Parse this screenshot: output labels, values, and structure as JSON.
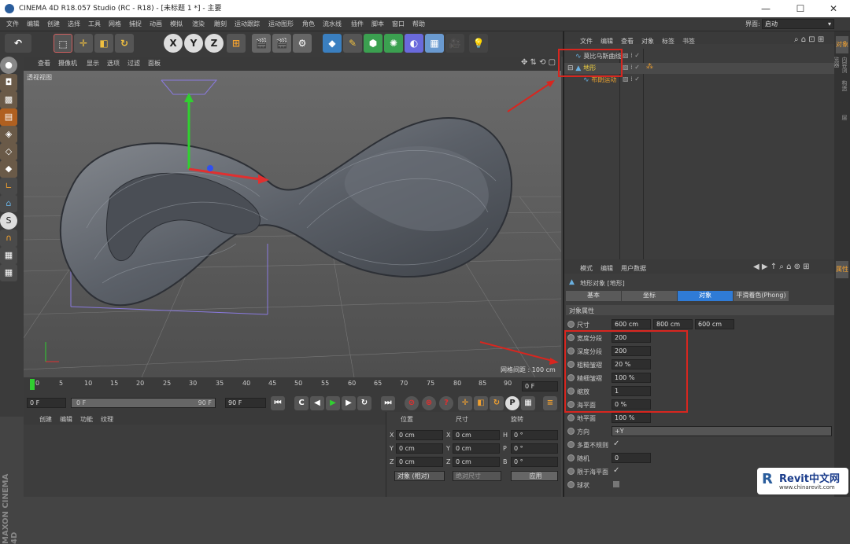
{
  "window": {
    "title": "CINEMA 4D R18.057 Studio (RC - R18) - [未标题 1 *] - 主要",
    "minimize": "—",
    "maximize": "☐",
    "close": "✕"
  },
  "menu": [
    "文件",
    "编辑",
    "创建",
    "选择",
    "工具",
    "网格",
    "捕捉",
    "动画",
    "模拟",
    "渲染",
    "雕刻",
    "运动跟踪",
    "运动图形",
    "角色",
    "流水线",
    "插件",
    "脚本",
    "窗口",
    "帮助"
  ],
  "layout": {
    "label": "界面:",
    "value": "启动"
  },
  "toolbar": {
    "x": "X",
    "y": "Y",
    "z": "Z"
  },
  "viewport": {
    "menu": [
      "查看",
      "摄像机",
      "显示",
      "选项",
      "过滤",
      "面板"
    ],
    "label": "透视视图",
    "grid": "网格间距 : 100 cm"
  },
  "timeline": {
    "ticks": [
      "0",
      "5",
      "10",
      "15",
      "20",
      "25",
      "30",
      "35",
      "40",
      "45",
      "50",
      "55",
      "60",
      "65",
      "70",
      "75",
      "80",
      "85",
      "90"
    ],
    "frame": "0 F"
  },
  "transport": {
    "start": "0 F",
    "slider_start": "0 F",
    "slider_end": "90 F",
    "end": "90 F"
  },
  "material": {
    "menu": [
      "创建",
      "编辑",
      "功能",
      "纹理"
    ]
  },
  "coords": {
    "headers": [
      "位置",
      "尺寸",
      "旋转"
    ],
    "rows": [
      {
        "a": "X",
        "v1": "0 cm",
        "b": "X",
        "v2": "0 cm",
        "c": "H",
        "v3": "0 °"
      },
      {
        "a": "Y",
        "v1": "0 cm",
        "b": "Y",
        "v2": "0 cm",
        "c": "P",
        "v3": "0 °"
      },
      {
        "a": "Z",
        "v1": "0 cm",
        "b": "Z",
        "v2": "0 cm",
        "c": "B",
        "v3": "0 °"
      }
    ],
    "mode": "对象 (相对)",
    "size": "绝对尺寸",
    "apply": "应用"
  },
  "objects": {
    "menu": [
      "文件",
      "编辑",
      "查看",
      "对象",
      "标签",
      "书签"
    ],
    "items": [
      {
        "name": "莫比乌斯曲线",
        "color": "#ccc"
      },
      {
        "name": "地形",
        "color": "#f0d040"
      },
      {
        "name": "布朗运动",
        "color": "#e8a030"
      }
    ]
  },
  "attributes": {
    "menu": [
      "模式",
      "编辑",
      "用户数据"
    ],
    "title": "地形对象 [地形]",
    "tabs": [
      "基本",
      "坐标",
      "对象",
      "平滑着色(Phong)"
    ],
    "section": "对象属性",
    "size_label": "尺寸",
    "size": [
      "600 cm",
      "800 cm",
      "600 cm"
    ],
    "props": [
      {
        "label": "宽度分段",
        "value": "200"
      },
      {
        "label": "深度分段",
        "value": "200"
      },
      {
        "label": "粗糙皱褶",
        "value": "20 %"
      },
      {
        "label": "精细皱褶",
        "value": "100 %"
      },
      {
        "label": "缩放",
        "value": "1"
      },
      {
        "label": "海平面",
        "value": "0 %"
      },
      {
        "label": "地平面",
        "value": "100 %"
      }
    ],
    "direction_label": "方向",
    "direction": "+Y",
    "checks": [
      {
        "label": "多重不规则",
        "value": "✓"
      },
      {
        "label": "随机",
        "value": "0"
      },
      {
        "label": "限于海平面",
        "value": "✓"
      },
      {
        "label": "球状",
        "value": ""
      }
    ]
  },
  "right_tabs": [
    "对象",
    "内容浏览器",
    "构造",
    "层"
  ],
  "attr_tab": "属性",
  "logo": {
    "line1": "MAXON",
    "line2": "CINEMA 4D"
  },
  "watermark": {
    "brand": "Revit中文网",
    "url": "www.chinarevit.com"
  }
}
